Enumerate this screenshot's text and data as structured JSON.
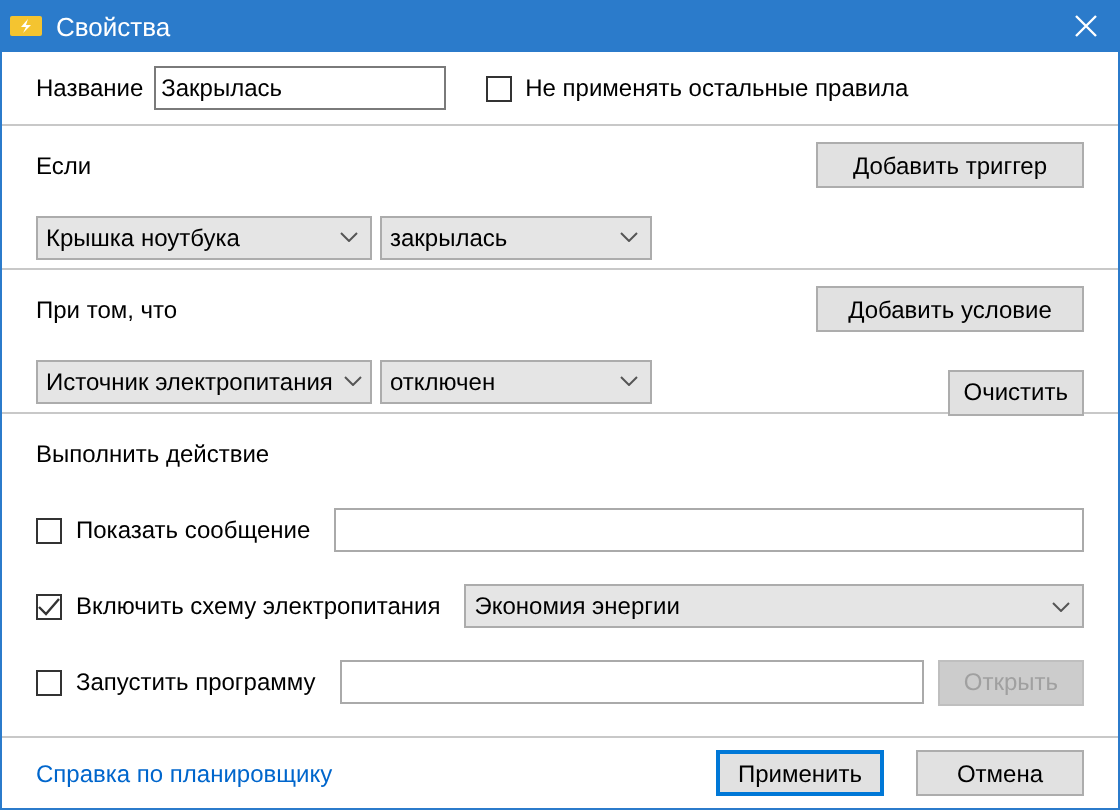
{
  "window": {
    "title": "Свойства"
  },
  "name": {
    "label": "Название",
    "value": "Закрылась"
  },
  "stop_rules": {
    "label": "Не применять остальные правила",
    "checked": false
  },
  "trigger": {
    "label": "Если",
    "add_button": "Добавить триггер",
    "dropdowns": [
      "Крышка ноутбука",
      "закрылась"
    ]
  },
  "condition": {
    "label": "При том, что",
    "add_button": "Добавить условие",
    "dropdowns": [
      "Источник электропитания",
      "отключен"
    ],
    "clear_button": "Очистить"
  },
  "actions": {
    "label": "Выполнить действие",
    "items": [
      {
        "kind": "text",
        "label": "Показать сообщение",
        "checked": false
      },
      {
        "kind": "dropdown",
        "label": "Включить схему электропитания",
        "checked": true,
        "value": "Экономия энергии"
      },
      {
        "kind": "program",
        "label": "Запустить программу",
        "checked": false,
        "button": "Открыть",
        "button_disabled": true
      }
    ]
  },
  "footer": {
    "link": "Справка по планировщику",
    "apply": "Применить",
    "cancel": "Отмена"
  }
}
